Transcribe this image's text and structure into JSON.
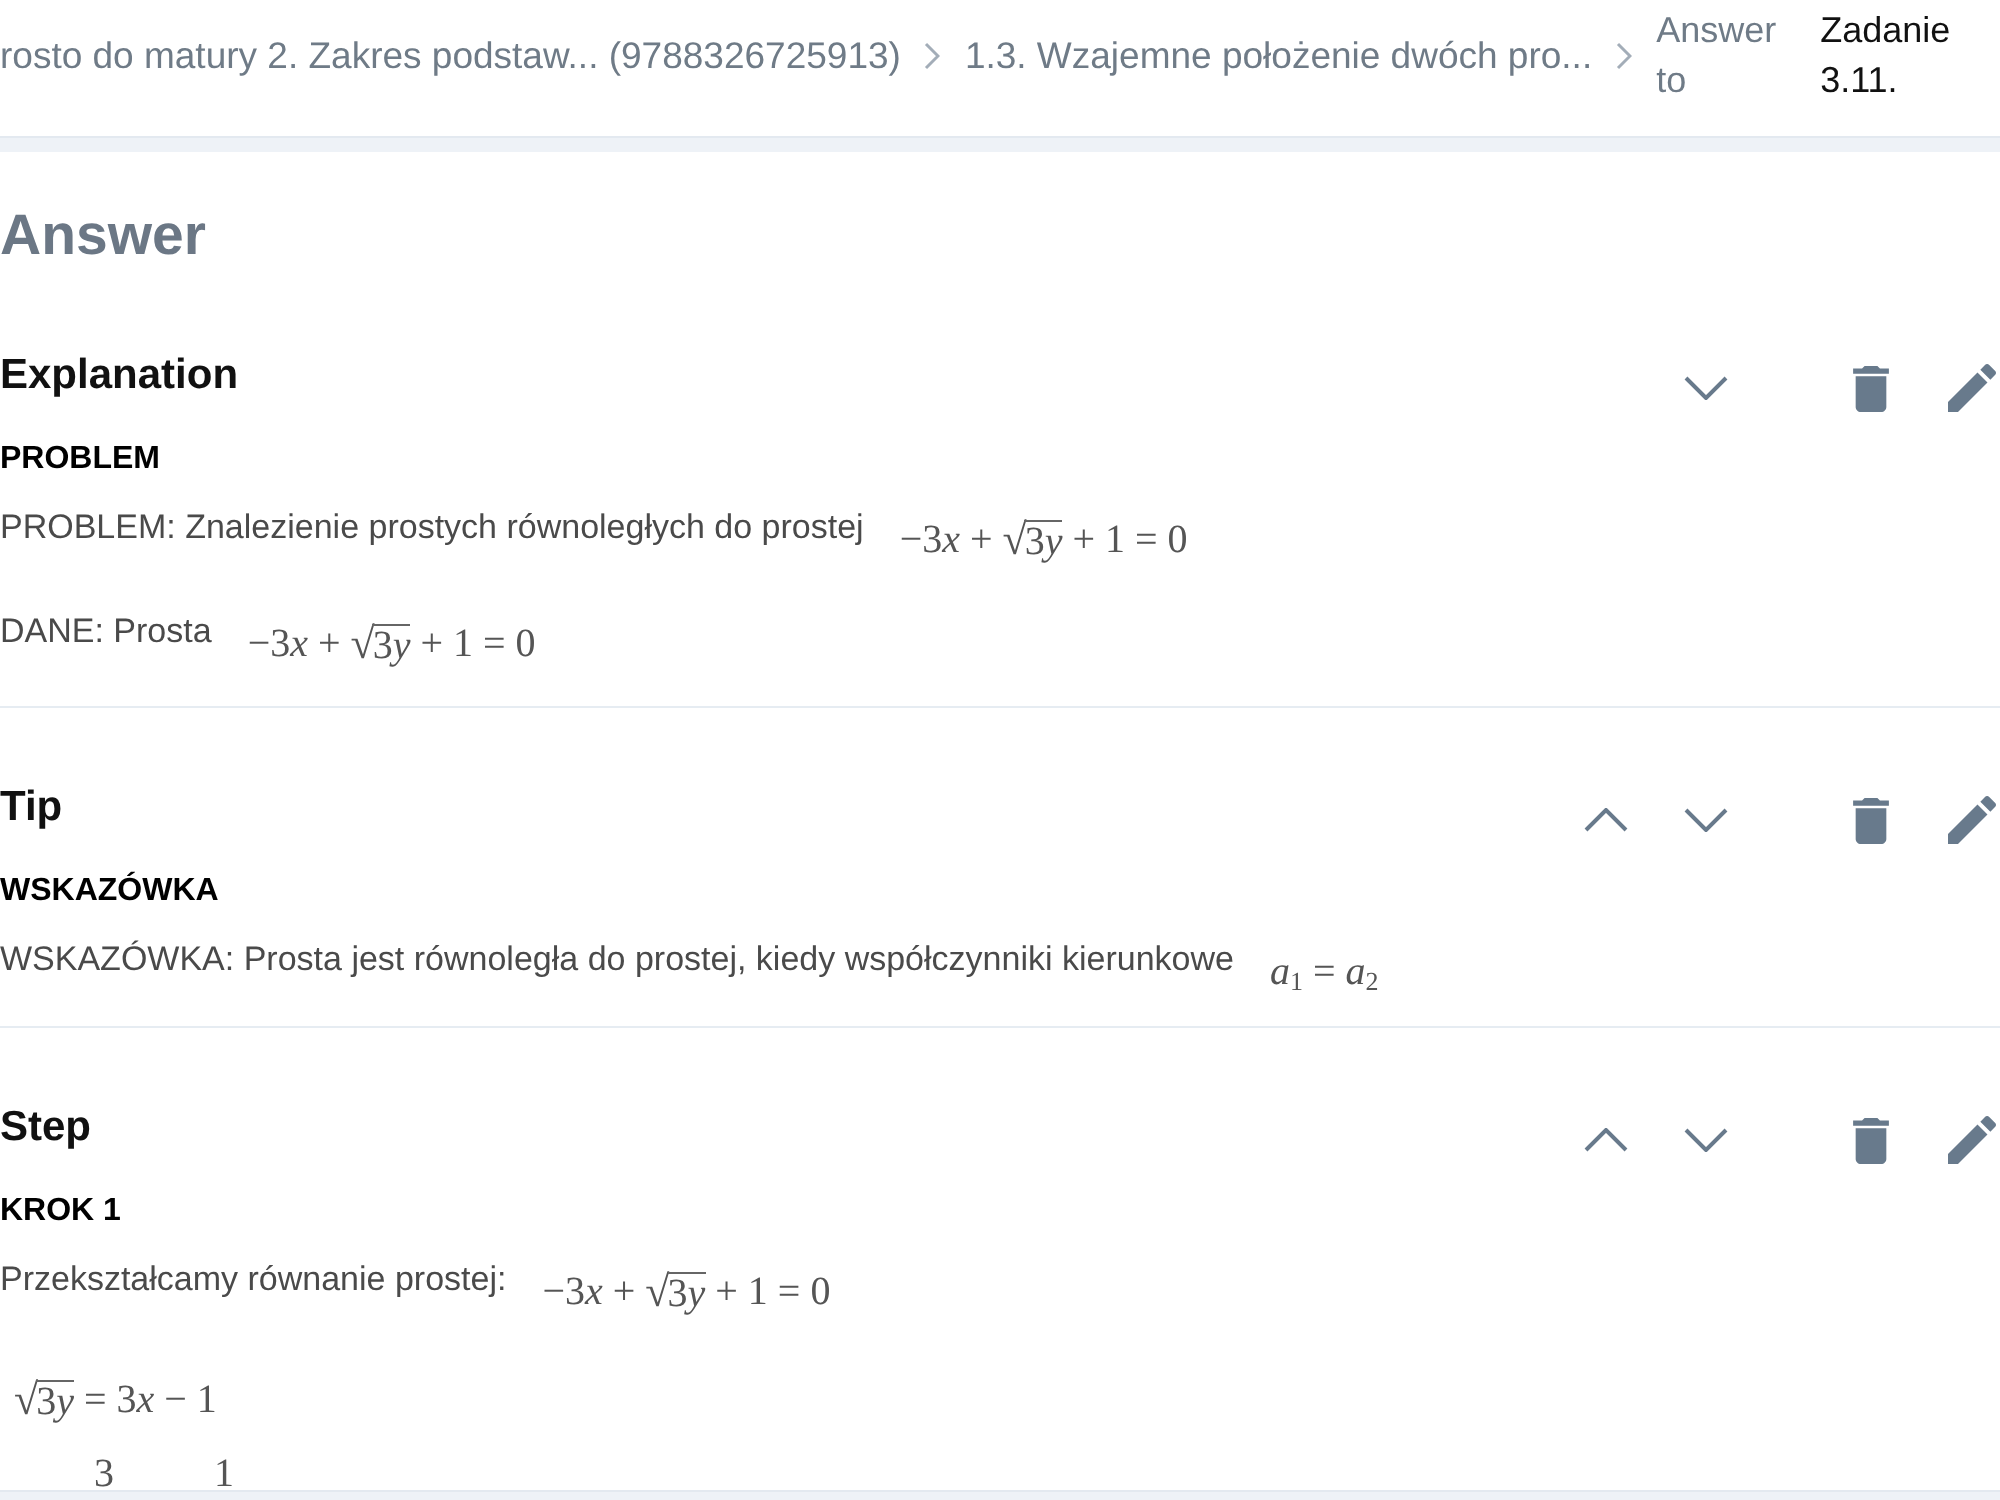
{
  "breadcrumb": {
    "items": [
      {
        "text": "rosto do matury 2. Zakres podstaw... (9788326725913)"
      },
      {
        "text": "1.3. Wzajemne położenie dwóch pro..."
      }
    ],
    "label": "Answer to",
    "current": "Zadanie 3.11."
  },
  "heading": "Answer",
  "sections": [
    {
      "title": "Explanation",
      "move_up": false,
      "move_down": true,
      "subheading": "PROBLEM",
      "blocks": [
        {
          "kind": "line",
          "text": "PROBLEM: Znalezienie prostych równoległych do prostej",
          "math": [
            {
              "kind": "plain",
              "text": "−3x + "
            },
            {
              "kind": "radical",
              "sign": "√",
              "radicand": "3y"
            },
            {
              "kind": "plain",
              "text": " + 1 = 0"
            }
          ]
        },
        {
          "kind": "line",
          "text": "DANE: Prosta",
          "math": [
            {
              "kind": "plain",
              "text": "−3x + "
            },
            {
              "kind": "radical",
              "sign": "√",
              "radicand": "3y"
            },
            {
              "kind": "plain",
              "text": " + 1 = 0"
            }
          ]
        }
      ]
    },
    {
      "title": "Tip",
      "move_up": true,
      "move_down": true,
      "subheading": "WSKAZÓWKA",
      "blocks": [
        {
          "kind": "line",
          "text": "WSKAZÓWKA: Prosta jest równoległa do prostej, kiedy współczynniki kierunkowe",
          "math": [
            {
              "kind": "plain",
              "text": "a$_{1}$ = a$_{2}$"
            }
          ]
        }
      ]
    },
    {
      "title": "Step",
      "move_up": true,
      "move_down": true,
      "subheading": "KROK 1",
      "blocks": [
        {
          "kind": "line",
          "text": "Przekształcamy równanie prostej:",
          "math": [
            {
              "kind": "plain",
              "text": "−3x + "
            },
            {
              "kind": "radical",
              "sign": "√",
              "radicand": "3y"
            },
            {
              "kind": "plain",
              "text": " + 1 = 0"
            }
          ]
        },
        {
          "kind": "math",
          "math": [
            {
              "kind": "radical",
              "sign": "√",
              "radicand": "3y"
            },
            {
              "kind": "plain",
              "text": " = 3x − 1"
            }
          ]
        },
        {
          "kind": "cut",
          "parts": [
            "3",
            "1"
          ]
        }
      ]
    }
  ]
}
